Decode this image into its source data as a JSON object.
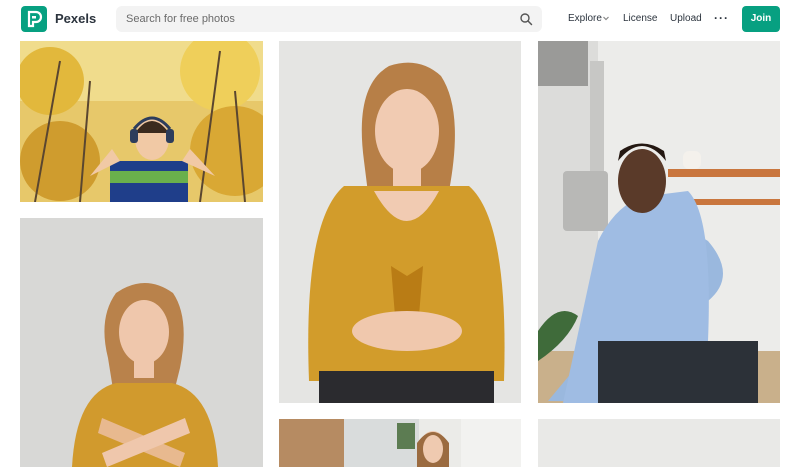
{
  "header": {
    "brand": "Pexels",
    "search_placeholder": "Search for free photos",
    "nav": {
      "explore": "Explore",
      "license": "License",
      "upload": "Upload",
      "more": "···"
    },
    "join_label": "Join",
    "accent_color": "#07a081",
    "icons": [
      "pexels-logo-icon",
      "search-icon",
      "chevron-down-icon",
      "more-icon"
    ]
  },
  "gallery": {
    "photos": [
      {
        "subject": "boy-with-headphones-autumn-trees"
      },
      {
        "subject": "woman-arms-crossed-mustard-top"
      },
      {
        "subject": "woman-open-hands-mustard-top"
      },
      {
        "subject": "man-blue-shirt-sitting-kitchen"
      },
      {
        "subject": "woman-mirror-reflection-partial"
      },
      {
        "subject": "light-wall-partial"
      }
    ]
  }
}
